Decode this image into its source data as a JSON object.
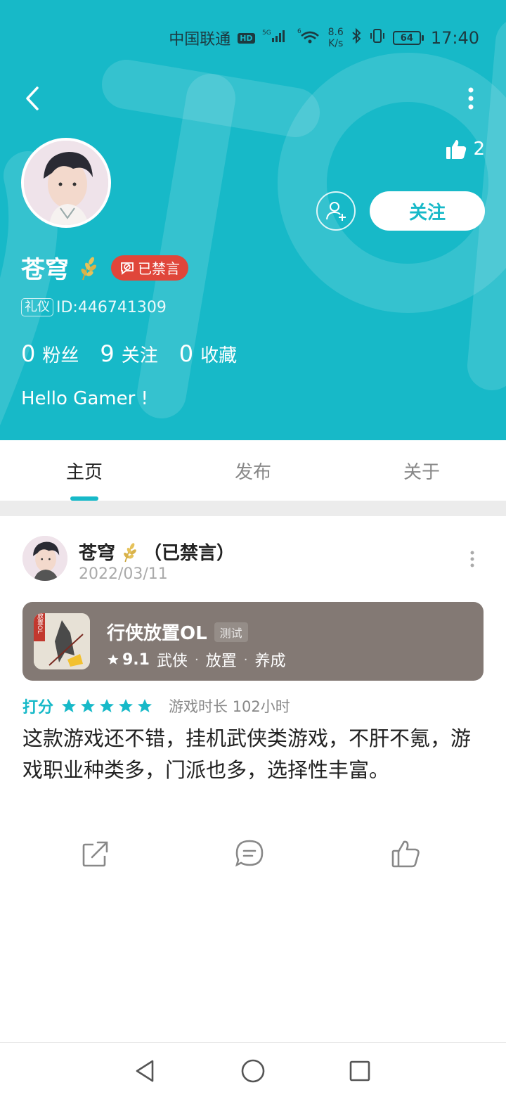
{
  "status_bar": {
    "carrier": "中国联通",
    "hd": "HD",
    "signal1": "5G",
    "signal2": "6",
    "net_speed_value": "8.6",
    "net_speed_unit": "K/s",
    "battery": "64",
    "time": "17:40"
  },
  "profile": {
    "like_count": "2",
    "follow_label": "关注",
    "name": "苍穹",
    "muted_badge": "已禁言",
    "etiquette_tag": "礼仪",
    "id_text": "ID:446741309",
    "stats": [
      {
        "value": "0",
        "label": "粉丝"
      },
      {
        "value": "9",
        "label": "关注"
      },
      {
        "value": "0",
        "label": "收藏"
      }
    ],
    "bio": "Hello Gamer !"
  },
  "tabs": [
    {
      "label": "主页",
      "active": true
    },
    {
      "label": "发布",
      "active": false
    },
    {
      "label": "关于",
      "active": false
    }
  ],
  "post": {
    "author": "苍穹",
    "author_suffix": "（已禁言）",
    "date": "2022/03/11",
    "game": {
      "title": "行侠放置OL",
      "tag": "测试",
      "score": "9.1",
      "genres": [
        "武侠",
        "放置",
        "养成"
      ],
      "icon_text": "放置OL"
    },
    "rating_label": "打分",
    "rating_stars": 5,
    "playtime": "游戏时长 102小时",
    "body": "这款游戏还不错，挂机武侠类游戏，不肝不氪，游戏职业种类多，门派也多，选择性丰富。"
  },
  "colors": {
    "accent": "#17b9c8",
    "muted_badge": "#e0463a",
    "game_card": "#837974"
  },
  "icons": {
    "back": "chevron-left-icon",
    "more": "more-vertical-icon",
    "like": "thumbs-up-icon",
    "add_friend": "add-user-icon",
    "wheat": "wheat-icon",
    "share": "share-icon",
    "comment": "comment-icon",
    "nav_back": "triangle-back-icon",
    "nav_home": "circle-home-icon",
    "nav_recent": "square-recent-icon"
  }
}
